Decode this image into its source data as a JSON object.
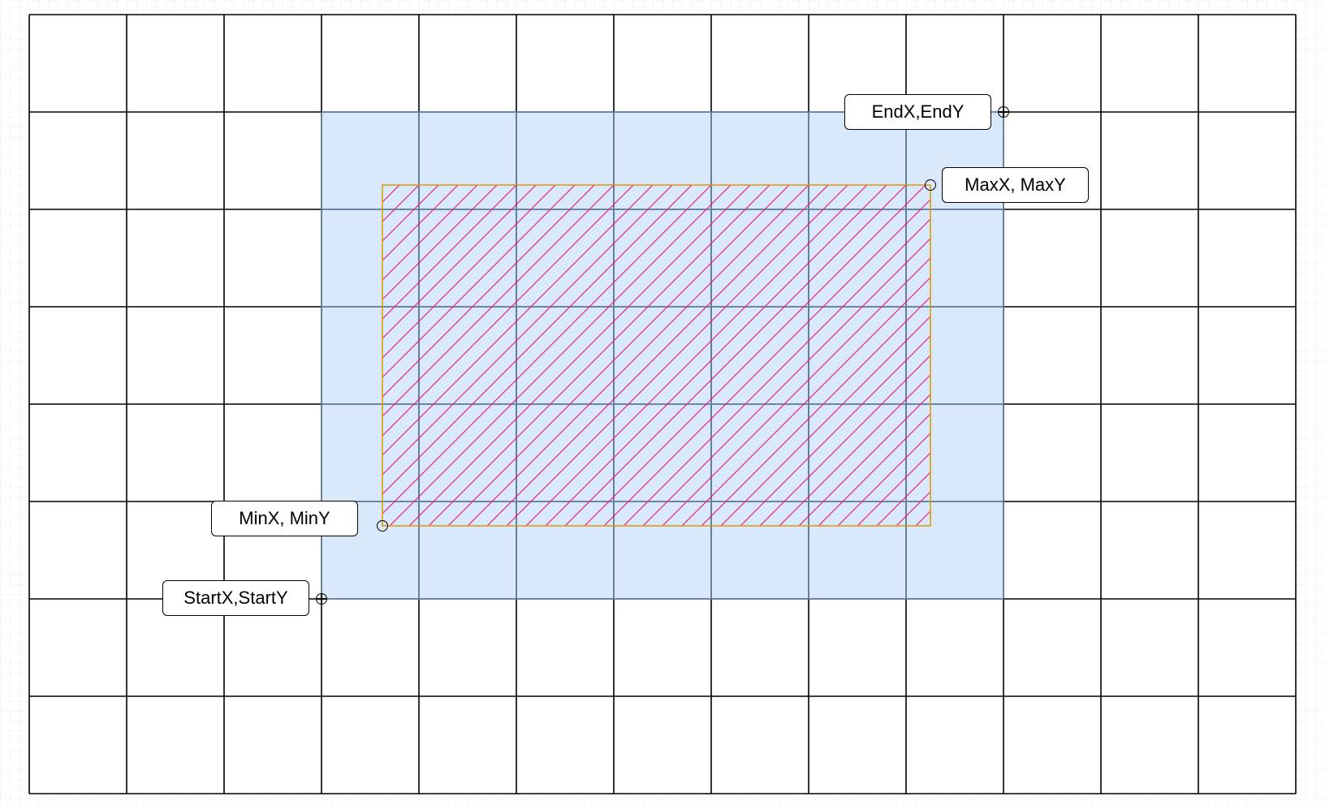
{
  "diagram": {
    "grid_columns": 13,
    "grid_rows": 8,
    "colors": {
      "background": "#ffffff",
      "background_grid": "#e8e8e8",
      "main_grid_line": "#000000",
      "selection_fill": "#dae8fc",
      "selection_grid_line": "#6c8ebf",
      "hatched_border": "#d79b00",
      "hatch_line": "#e6288f"
    },
    "labels": {
      "end_point": "EndX,EndY",
      "max_point": "MaxX, MaxY",
      "min_point": "MinX, MinY",
      "start_point": "StartX,StartY"
    },
    "icons": {
      "end_handle": "crosshair-circle-icon",
      "max_handle": "circle-handle-icon",
      "min_handle": "circle-handle-icon",
      "start_handle": "crosshair-circle-icon"
    }
  }
}
